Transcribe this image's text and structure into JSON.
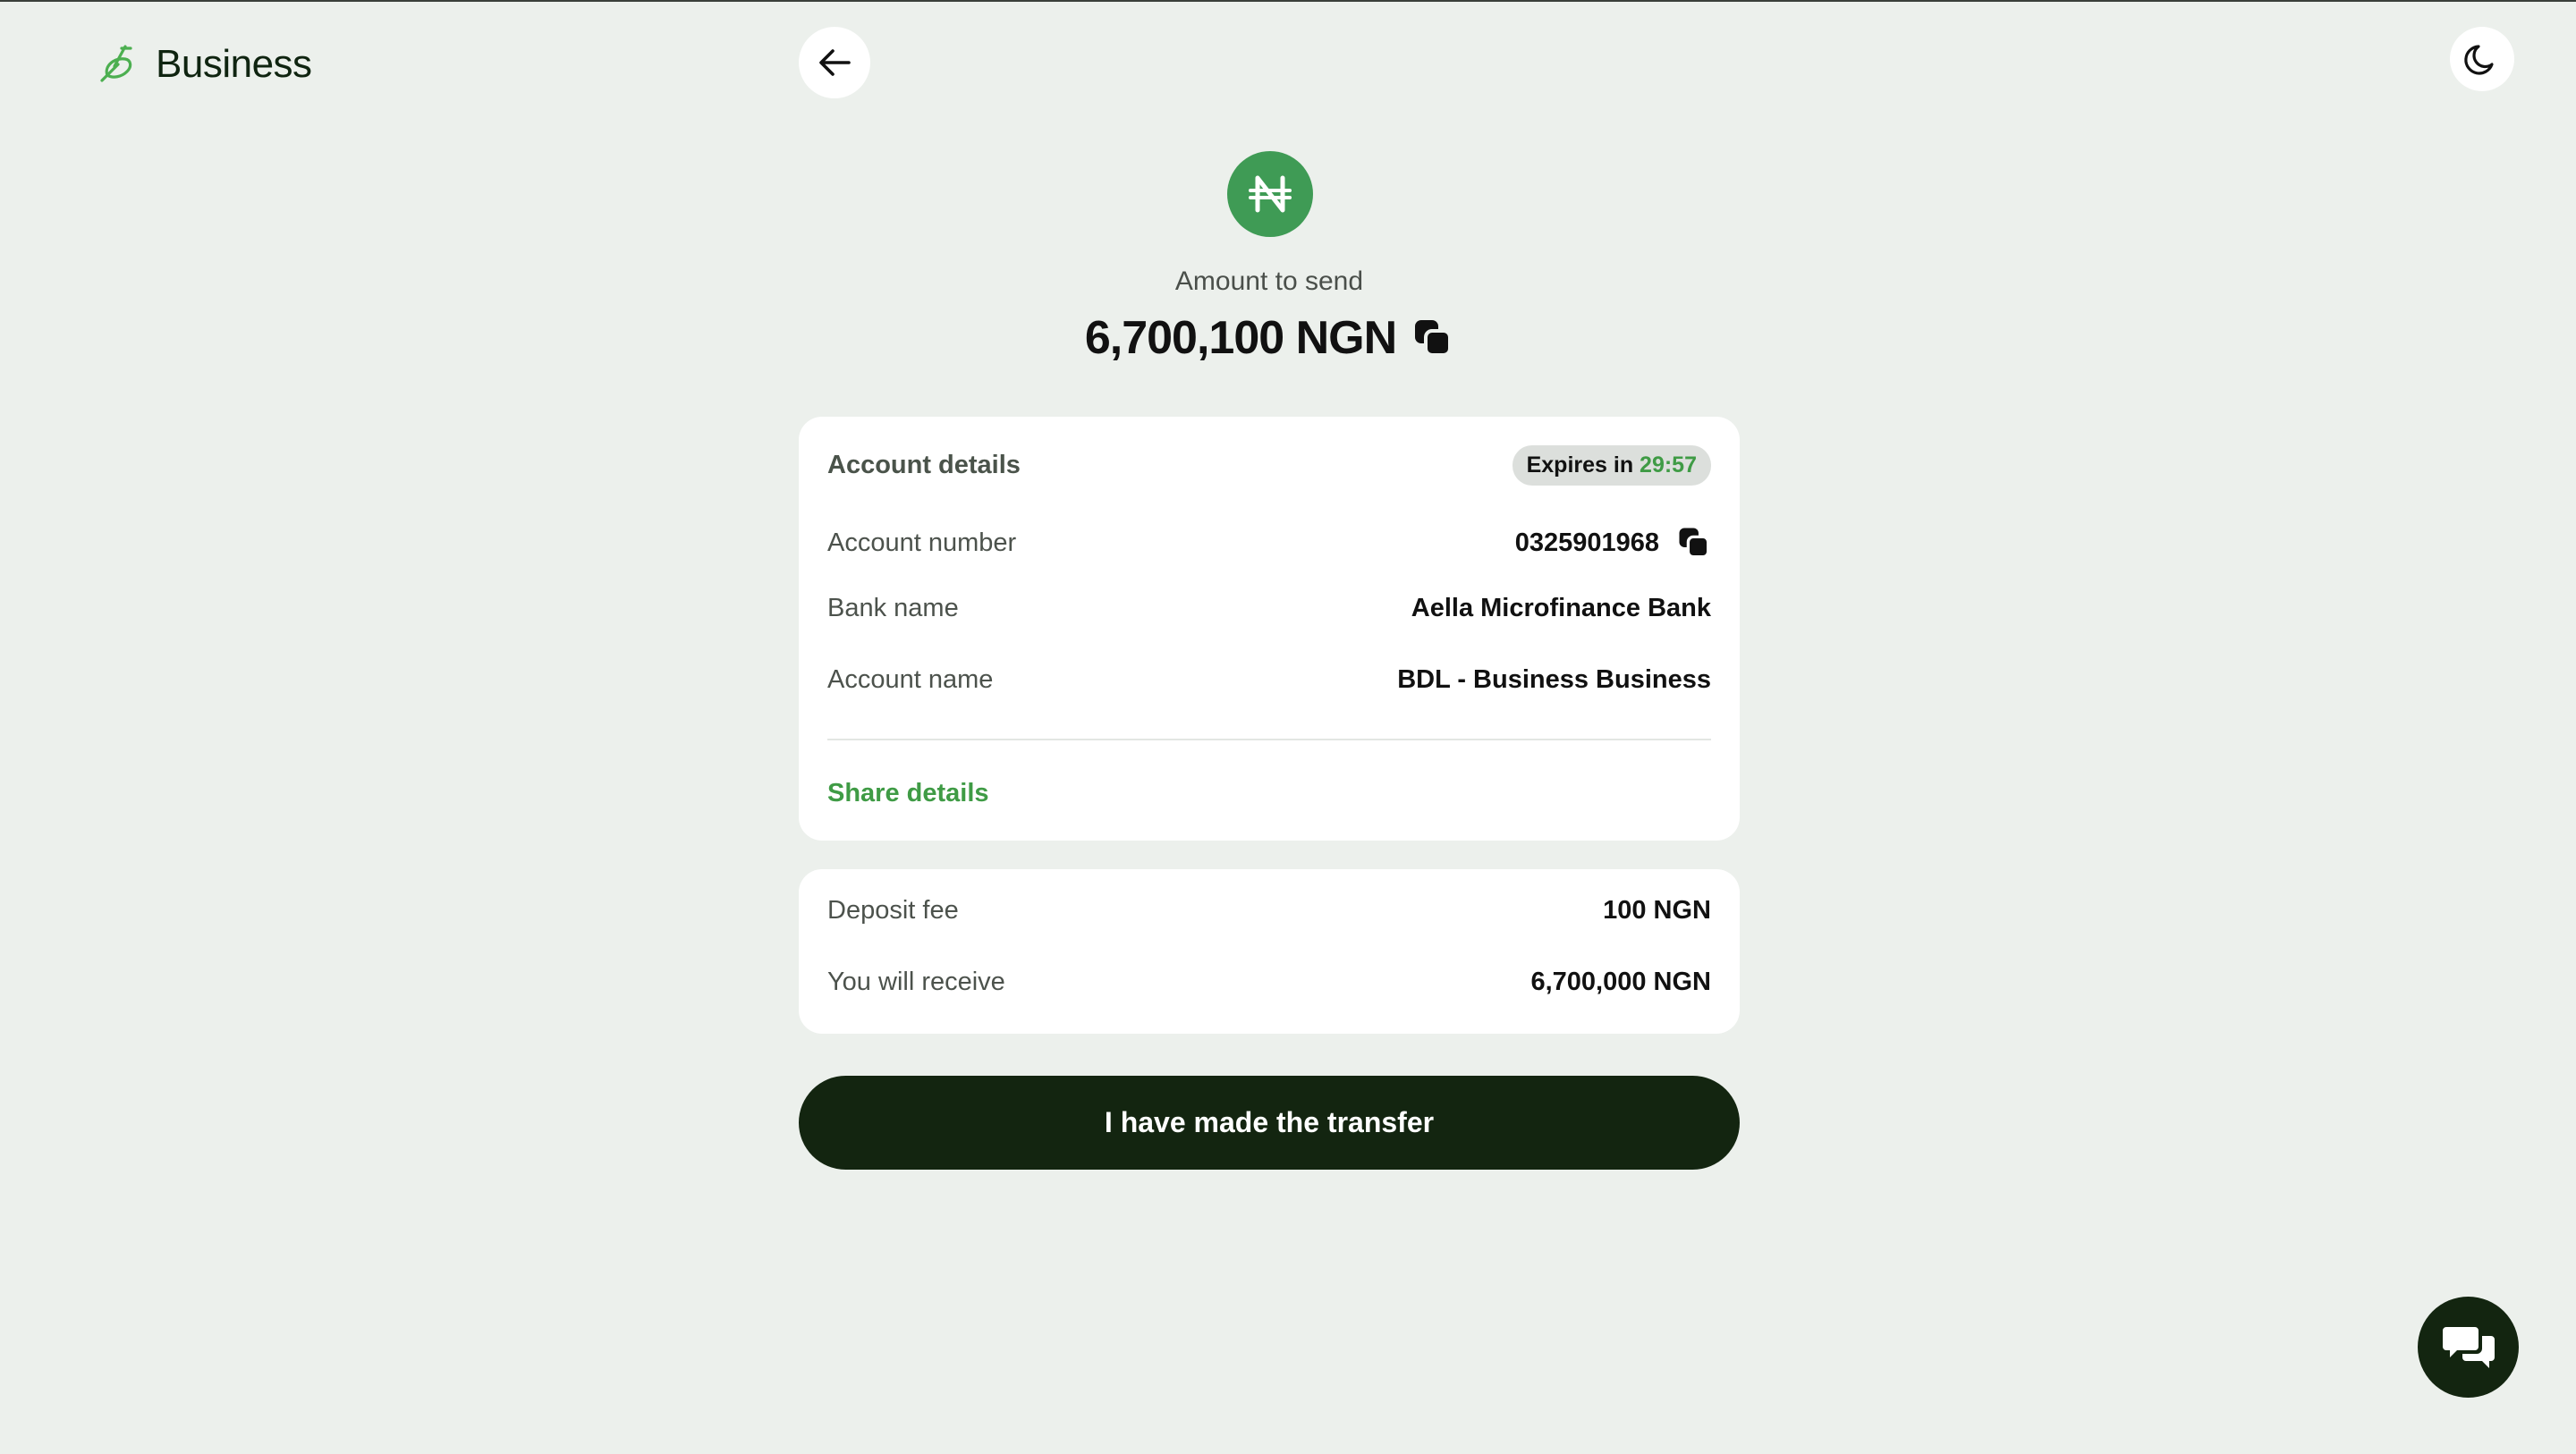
{
  "header": {
    "logo_text": "Business"
  },
  "icons": {
    "logo": "leaf-logo-icon",
    "back": "arrow-left-icon",
    "theme": "moon-icon",
    "currency": "naira-icon",
    "copy": "copy-icon",
    "chat": "chat-icon"
  },
  "amount": {
    "label": "Amount to send",
    "value": "6,700,100 NGN",
    "currency_symbol": "₦"
  },
  "account_card": {
    "title": "Account details",
    "expires_label": "Expires in",
    "expires_time": "29:57",
    "rows": [
      {
        "label": "Account number",
        "value": "0325901968"
      },
      {
        "label": "Bank name",
        "value": "Aella Microfinance Bank"
      },
      {
        "label": "Account name",
        "value": "BDL - Business Business"
      }
    ],
    "share_label": "Share details"
  },
  "fee_card": {
    "rows": [
      {
        "label": "Deposit fee",
        "value": "100 NGN"
      },
      {
        "label": "You will receive",
        "value": "6,700,000 NGN"
      }
    ]
  },
  "primary_button": {
    "label": "I have made the transfer"
  },
  "colors": {
    "background": "#ecf0ec",
    "accent_green": "#3f9b45",
    "brand_dark": "#132510",
    "card": "#ffffff"
  }
}
